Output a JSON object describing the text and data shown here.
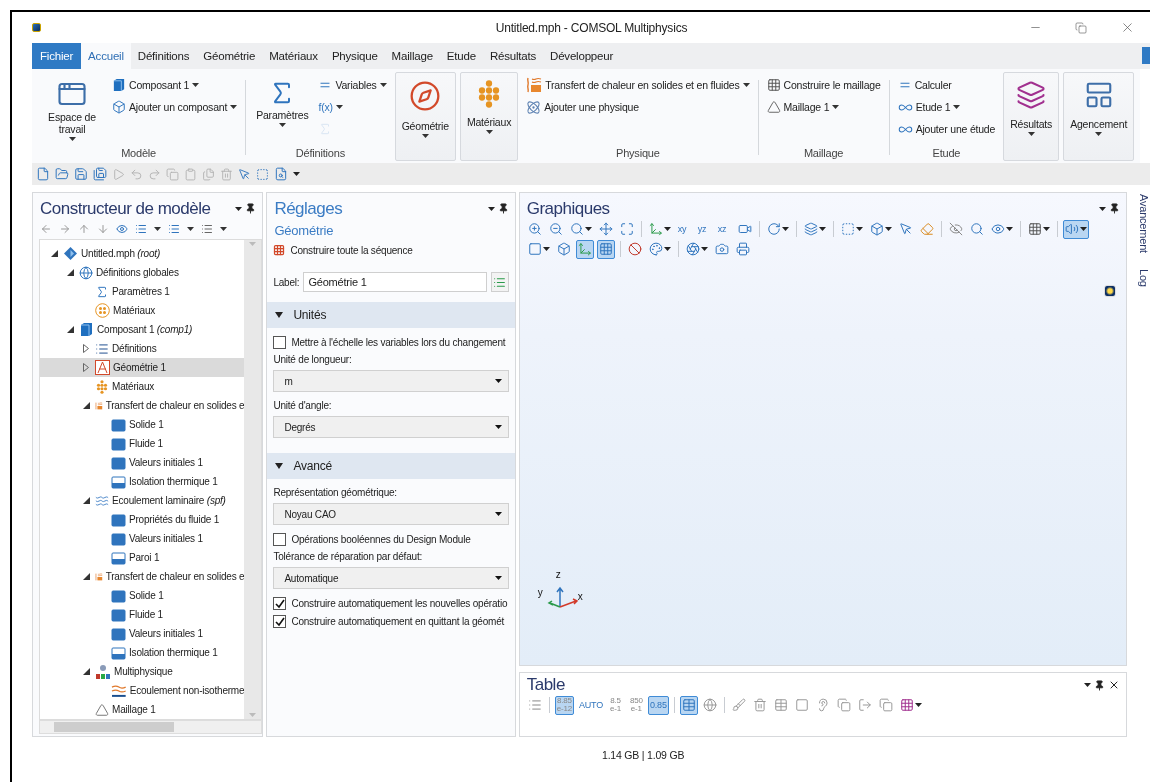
{
  "window": {
    "title": "Untitled.mph - COMSOL Multiphysics"
  },
  "menu_tabs": [
    {
      "label": "Fichier",
      "kind": "file",
      "selected": false
    },
    {
      "label": "Accueil",
      "kind": "tab",
      "selected": true
    },
    {
      "label": "Définitions",
      "kind": "tab",
      "selected": false
    },
    {
      "label": "Géométrie",
      "kind": "tab",
      "selected": false
    },
    {
      "label": "Matériaux",
      "kind": "tab",
      "selected": false
    },
    {
      "label": "Physique",
      "kind": "tab",
      "selected": false
    },
    {
      "label": "Maillage",
      "kind": "tab",
      "selected": false
    },
    {
      "label": "Etude",
      "kind": "tab",
      "selected": false
    },
    {
      "label": "Résultats",
      "kind": "tab",
      "selected": false
    },
    {
      "label": "Développeur",
      "kind": "tab",
      "selected": false
    }
  ],
  "ribbon": {
    "groups": [
      {
        "kind": "group",
        "title": "Modèle",
        "columns": [
          [
            {
              "kind": "large",
              "label": "Espace de travail",
              "dropdown": true,
              "disabled": false
            }
          ],
          [
            {
              "kind": "small",
              "label": "Composant 1",
              "dropdown": true,
              "disabled": false
            },
            {
              "kind": "small",
              "label": "Ajouter un composant",
              "dropdown": true,
              "disabled": false
            }
          ]
        ]
      },
      {
        "kind": "group",
        "title": "Définitions",
        "columns": [
          [
            {
              "kind": "large",
              "label": "Paramètres",
              "dropdown": true,
              "disabled": false
            }
          ],
          [
            {
              "kind": "small",
              "label": "Variables",
              "dropdown": true,
              "disabled": false
            },
            {
              "kind": "small",
              "label": "f(x)",
              "dropdown": true,
              "disabled": false
            },
            {
              "kind": "small",
              "dropdown": false,
              "disabled": true
            }
          ]
        ]
      },
      {
        "kind": "framed",
        "columns": [
          [
            {
              "kind": "large",
              "label": "Géométrie",
              "dropdown": true,
              "disabled": false
            }
          ]
        ]
      },
      {
        "kind": "framed",
        "columns": [
          [
            {
              "kind": "large",
              "label": "Matériaux",
              "dropdown": true,
              "disabled": false
            }
          ]
        ]
      },
      {
        "kind": "group",
        "title": "Physique",
        "columns": [
          [
            {
              "kind": "small",
              "label": "Transfert de chaleur en solides et en fluides",
              "dropdown": true,
              "disabled": false
            },
            {
              "kind": "small",
              "label": "Ajouter une physique",
              "dropdown": false,
              "disabled": false
            }
          ]
        ]
      },
      {
        "kind": "group",
        "title": "Maillage",
        "columns": [
          [
            {
              "kind": "small",
              "label": "Construire le maillage",
              "dropdown": false,
              "disabled": false
            },
            {
              "kind": "small",
              "label": "Maillage 1",
              "dropdown": true,
              "disabled": false
            }
          ]
        ]
      },
      {
        "kind": "group",
        "title": "Etude",
        "columns": [
          [
            {
              "kind": "small",
              "label": "Calculer",
              "dropdown": false,
              "disabled": false
            },
            {
              "kind": "small",
              "label": "Etude 1",
              "dropdown": true,
              "disabled": false
            },
            {
              "kind": "small",
              "label": "Ajouter une étude",
              "dropdown": false,
              "disabled": false
            }
          ]
        ]
      },
      {
        "kind": "framed",
        "columns": [
          [
            {
              "kind": "large",
              "label": "Résultats",
              "dropdown": true,
              "disabled": false
            }
          ]
        ]
      },
      {
        "kind": "framed",
        "columns": [
          [
            {
              "kind": "large",
              "label": "Agencement",
              "dropdown": true,
              "disabled": false
            }
          ]
        ]
      }
    ]
  },
  "quick_access": [
    {
      "disabled": false
    },
    {
      "disabled": false
    },
    {
      "disabled": false
    },
    {
      "disabled": false
    },
    {
      "disabled": true
    },
    {
      "disabled": true
    },
    {
      "disabled": true
    },
    {
      "disabled": true
    },
    {
      "disabled": true
    },
    {
      "disabled": true
    },
    {
      "disabled": true
    },
    {
      "disabled": false
    },
    {
      "disabled": false
    },
    {
      "disabled": false
    }
  ],
  "model_builder": {
    "title": "Constructeur de modèle",
    "tree": [
      {
        "label": "Untitled.mph *(root)*",
        "kind": "root",
        "expanded": true,
        "selected": false,
        "children": [
          {
            "label": "Définitions globales",
            "kind": "globe",
            "expanded": true,
            "selected": false,
            "children": [
              {
                "label": "Paramètres 1",
                "kind": "params",
                "selected": false
              },
              {
                "label": "Matériaux",
                "kind": "materials-global",
                "selected": false
              }
            ]
          },
          {
            "label": "Composant 1 *(comp1)*",
            "kind": "component",
            "expanded": true,
            "selected": false,
            "children": [
              {
                "label": "Définitions",
                "kind": "definitions",
                "expanded": false,
                "selected": false
              },
              {
                "label": "Géométrie 1",
                "kind": "geometry",
                "expanded": false,
                "selected": true
              },
              {
                "label": "Matériaux",
                "kind": "materials",
                "selected": false
              },
              {
                "label": "Transfert de chaleur en solides e",
                "kind": "physics-heat",
                "expanded": true,
                "selected": false,
                "children": [
                  {
                    "label": "Solide 1",
                    "kind": "feature",
                    "selected": false
                  },
                  {
                    "label": "Fluide 1",
                    "kind": "feature",
                    "selected": false
                  },
                  {
                    "label": "Valeurs initiales 1",
                    "kind": "feature",
                    "selected": false
                  },
                  {
                    "label": "Isolation thermique 1",
                    "kind": "boundary",
                    "selected": false
                  }
                ]
              },
              {
                "label": "Ecoulement laminaire *(spf)*",
                "kind": "physics-flow",
                "expanded": true,
                "selected": false,
                "children": [
                  {
                    "label": "Propriétés du fluide 1",
                    "kind": "feature",
                    "selected": false
                  },
                  {
                    "label": "Valeurs initiales 1",
                    "kind": "feature",
                    "selected": false
                  },
                  {
                    "label": "Paroi 1",
                    "kind": "boundary",
                    "selected": false
                  }
                ]
              },
              {
                "label": "Transfert de chaleur en solides e",
                "kind": "physics-heat",
                "expanded": true,
                "selected": false,
                "children": [
                  {
                    "label": "Solide 1",
                    "kind": "feature",
                    "selected": false
                  },
                  {
                    "label": "Fluide 1",
                    "kind": "feature",
                    "selected": false
                  },
                  {
                    "label": "Valeurs initiales 1",
                    "kind": "feature",
                    "selected": false
                  },
                  {
                    "label": "Isolation thermique 1",
                    "kind": "boundary",
                    "selected": false
                  }
                ]
              },
              {
                "label": "Multiphysique",
                "kind": "multiphysics",
                "expanded": true,
                "selected": false,
                "children": [
                  {
                    "label": "Ecoulement non-isotherme",
                    "kind": "coupling",
                    "selected": false
                  }
                ]
              },
              {
                "label": "Maillage 1",
                "kind": "mesh",
                "selected": false
              }
            ]
          }
        ]
      }
    ]
  },
  "settings": {
    "title": "Réglages",
    "subtitle": "Géométrie",
    "action": "Construire toute la séquence",
    "label_field": {
      "label": "Label:",
      "value": "Géométrie 1"
    },
    "sections": [
      {
        "title": "Unités",
        "expanded": true,
        "fields": [
          {
            "kind": "checkbox",
            "label": "Mettre à l'échelle les variables lors du changement",
            "checked": false
          },
          {
            "kind": "select",
            "label": "Unité de longueur:",
            "value": "m"
          },
          {
            "kind": "select",
            "label": "Unité d'angle:",
            "value": "Degrés"
          }
        ]
      },
      {
        "title": "Avancé",
        "expanded": true,
        "fields": [
          {
            "kind": "select",
            "label": "Représentation géométrique:",
            "value": "Noyau CAO"
          },
          {
            "kind": "checkbox",
            "label": "Opérations booléennes du Design Module",
            "checked": false
          },
          {
            "kind": "select",
            "label": "Tolérance de réparation par défaut:",
            "value": "Automatique"
          },
          {
            "kind": "checkbox",
            "label": "Construire automatiquement les nouvelles opératio",
            "checked": true
          },
          {
            "kind": "checkbox",
            "label": "Construire automatiquement en quittant la géomét",
            "checked": true
          }
        ]
      }
    ]
  },
  "graphics": {
    "title": "Graphiques",
    "toolbar": [
      [
        {
          "kind": "button",
          "dropdown": false,
          "selected": false
        },
        {
          "kind": "button",
          "dropdown": false,
          "selected": false
        },
        {
          "kind": "button",
          "dropdown": true,
          "selected": false
        },
        {
          "kind": "button",
          "dropdown": false,
          "selected": false
        },
        {
          "kind": "button",
          "dropdown": false,
          "selected": false
        },
        {
          "kind": "separator"
        },
        {
          "kind": "button",
          "dropdown": true,
          "selected": false
        },
        {
          "kind": "button",
          "label": "xy",
          "dropdown": false,
          "selected": false
        },
        {
          "kind": "button",
          "label": "yz",
          "dropdown": false,
          "selected": false
        },
        {
          "kind": "button",
          "label": "xz",
          "dropdown": false,
          "selected": false
        },
        {
          "kind": "button",
          "dropdown": false,
          "selected": false
        },
        {
          "kind": "separator"
        },
        {
          "kind": "button",
          "dropdown": true,
          "selected": false
        },
        {
          "kind": "separator"
        },
        {
          "kind": "button",
          "dropdown": true,
          "selected": false
        },
        {
          "kind": "separator"
        },
        {
          "kind": "button",
          "dropdown": true,
          "selected": false
        },
        {
          "kind": "button",
          "dropdown": true,
          "selected": false
        },
        {
          "kind": "button",
          "dropdown": false,
          "selected": false
        },
        {
          "kind": "button",
          "dropdown": false,
          "selected": false
        },
        {
          "kind": "separator"
        },
        {
          "kind": "button",
          "dropdown": false,
          "selected": false
        },
        {
          "kind": "button",
          "dropdown": false,
          "selected": false
        },
        {
          "kind": "button",
          "dropdown": true,
          "selected": false
        },
        {
          "kind": "separator"
        },
        {
          "kind": "button",
          "dropdown": true,
          "selected": false
        },
        {
          "kind": "separator"
        },
        {
          "kind": "button",
          "dropdown": true,
          "selected": true
        }
      ],
      [
        {
          "kind": "button",
          "dropdown": true,
          "selected": false
        },
        {
          "kind": "button",
          "dropdown": false,
          "selected": false
        },
        {
          "kind": "button",
          "dropdown": false,
          "selected": true
        },
        {
          "kind": "button",
          "dropdown": false,
          "selected": true
        },
        {
          "kind": "separator"
        },
        {
          "kind": "button",
          "dropdown": false,
          "selected": false
        },
        {
          "kind": "button",
          "dropdown": true,
          "selected": false
        },
        {
          "kind": "separator"
        },
        {
          "kind": "button",
          "dropdown": true,
          "selected": false
        },
        {
          "kind": "button",
          "dropdown": false,
          "selected": false
        },
        {
          "kind": "button",
          "dropdown": false,
          "selected": false
        }
      ]
    ],
    "axis_labels": [
      "z",
      "y",
      "x"
    ]
  },
  "table": {
    "title": "Table",
    "toolbar": [
      {
        "kind": "button",
        "dropdown": false,
        "selected": false
      },
      {
        "kind": "separator"
      },
      {
        "kind": "button",
        "label": "8.85",
        "sublabel": "e-12",
        "dropdown": false,
        "selected": true
      },
      {
        "kind": "button",
        "label": "AUTO",
        "dropdown": false,
        "selected": false
      },
      {
        "kind": "button",
        "label": "8.5",
        "sublabel": "e-1",
        "dropdown": false,
        "selected": false
      },
      {
        "kind": "button",
        "label": "850",
        "sublabel": "e-1",
        "dropdown": false,
        "selected": false
      },
      {
        "kind": "button",
        "label": "0.85",
        "dropdown": false,
        "selected": true
      },
      {
        "kind": "separator"
      },
      {
        "kind": "button",
        "dropdown": false,
        "selected": true
      },
      {
        "kind": "button",
        "dropdown": false,
        "selected": false
      },
      {
        "kind": "separator"
      },
      {
        "kind": "button",
        "dropdown": false,
        "selected": false
      },
      {
        "kind": "button",
        "dropdown": false,
        "selected": false
      },
      {
        "kind": "button",
        "dropdown": false,
        "selected": false
      },
      {
        "kind": "button",
        "dropdown": false,
        "selected": false
      },
      {
        "kind": "button",
        "dropdown": false,
        "selected": false
      },
      {
        "kind": "button",
        "dropdown": false,
        "selected": false
      },
      {
        "kind": "button",
        "dropdown": false,
        "selected": false
      },
      {
        "kind": "button",
        "dropdown": false,
        "selected": false
      },
      {
        "kind": "button",
        "dropdown": true,
        "selected": false
      }
    ]
  },
  "side_tabs": [
    "Avancement",
    "Log"
  ],
  "status_bar": {
    "memory": "1.14 GB | 1.09 GB"
  }
}
